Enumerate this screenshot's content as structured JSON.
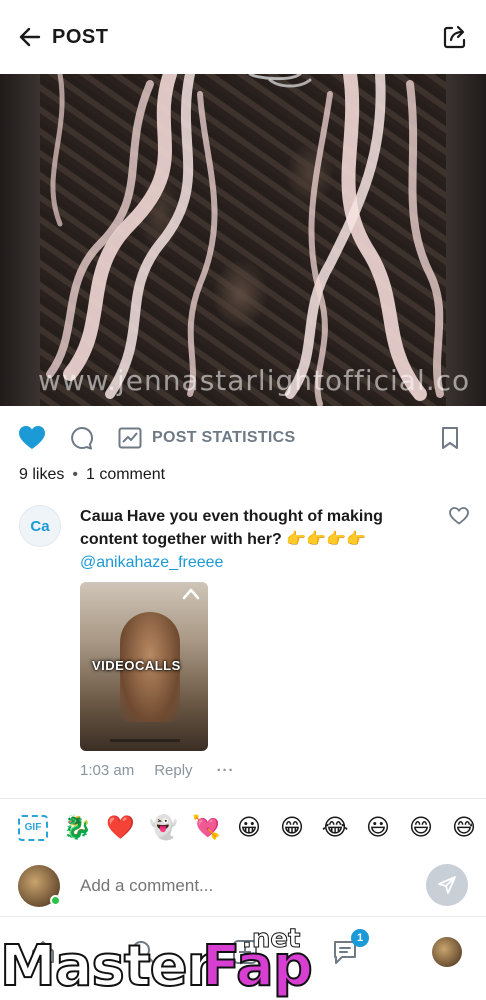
{
  "header": {
    "title": "POST",
    "back_icon": "arrow-left-icon",
    "share_icon": "share-external-icon"
  },
  "post": {
    "watermark": "www.jennastarlightofficial.co"
  },
  "actions": {
    "stats_label": "POST STATISTICS",
    "liked": true,
    "colors": {
      "like": "#1c9ad6",
      "muted": "#6f7a85"
    }
  },
  "likes": {
    "likes_text": "9 likes",
    "comments_text": "1 comment"
  },
  "comment": {
    "avatar_initials": "Ca",
    "author": "Саша",
    "text": "Have you even thought of making content together with her? 👉👉👉👉",
    "mention": "@anikahaze_freeee",
    "thumb_label": "VIDEOCALLS",
    "time": "1:03 am",
    "reply_label": "Reply",
    "more_label": "···"
  },
  "emoji_bar": {
    "gif_label": "GIF",
    "emojis": [
      "🐉",
      "❤️",
      "👻",
      "💘",
      "😀",
      "😁",
      "😂",
      "😃",
      "😄",
      "😅"
    ]
  },
  "add_comment": {
    "placeholder": "Add a comment...",
    "online": true
  },
  "nav": {
    "messages_badge": "1"
  },
  "site_watermark": {
    "part1": "Master",
    "part2": "Fap",
    "part3": ".net"
  }
}
